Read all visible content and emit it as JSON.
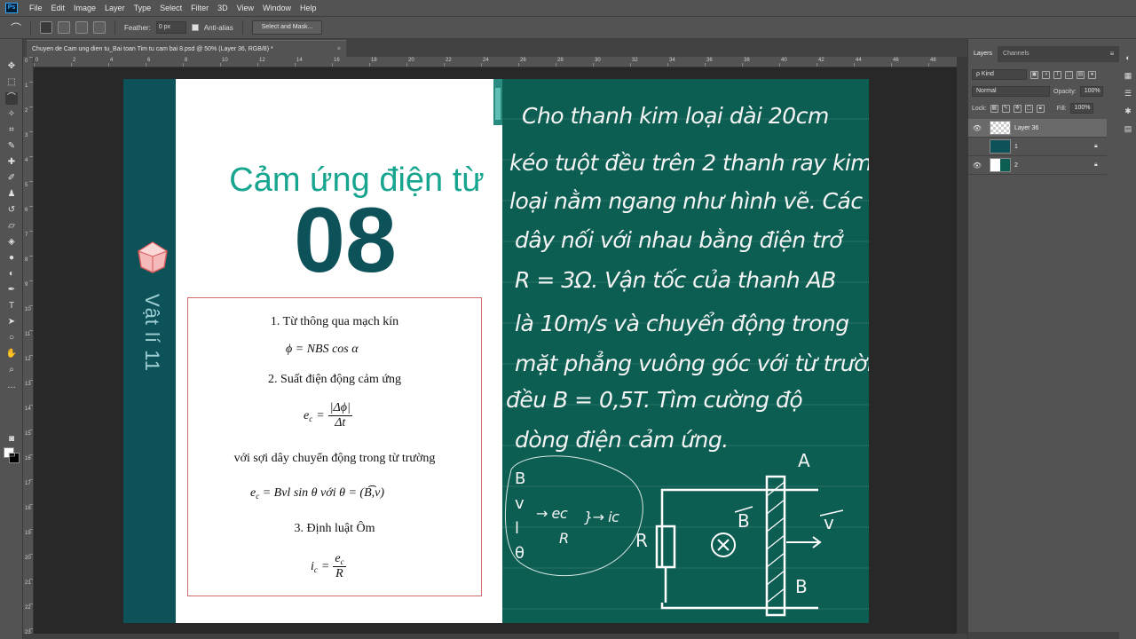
{
  "app": {
    "logo": "Ps",
    "menu": [
      "File",
      "Edit",
      "Image",
      "Layer",
      "Type",
      "Select",
      "Filter",
      "3D",
      "View",
      "Window",
      "Help"
    ]
  },
  "options_bar": {
    "feather_label": "Feather:",
    "feather_value": "0 px",
    "antialias_label": "Anti-alias",
    "select_mask_label": "Select and Mask..."
  },
  "document": {
    "tab_title": "Chuyen de Cam ung dien tu_Bai toan Tim tu cam bai 8.psd @ 50% (Layer 36, RGB/8) *",
    "close": "×",
    "ruler_h": [
      "0",
      "2",
      "4",
      "6",
      "8",
      "10",
      "12",
      "14",
      "16",
      "18",
      "20",
      "22",
      "24",
      "26",
      "28",
      "30",
      "32",
      "34",
      "36",
      "38",
      "40",
      "42",
      "44",
      "46",
      "48",
      "50"
    ],
    "ruler_v": [
      "0",
      "1",
      "2",
      "3",
      "4",
      "5",
      "6",
      "7",
      "8",
      "9",
      "10",
      "11",
      "12",
      "13",
      "14",
      "15",
      "16",
      "17",
      "18",
      "19",
      "20",
      "21",
      "22",
      "23"
    ]
  },
  "slide": {
    "vertical_title": "Vật lí 11",
    "topic_title": "Cảm ứng điện từ",
    "lesson_number": "08",
    "formulas": {
      "h1": "1. Từ thông qua mạch kín",
      "f1": "ϕ = NBS cos α",
      "h2": "2. Suất điện động cảm ứng",
      "f2_lhs": "e",
      "f2_sub": "c",
      "f2_num": "|Δϕ|",
      "f2_den": "Δt",
      "h2b": "với sợi dây chuyển động trong từ trường",
      "f3": "e",
      "f3_sub": "c",
      "f3_rest": " = Bvl sin θ  với  θ = (B͡,v)",
      "h3": "3. Định luật Ôm",
      "f4_lhs": "i",
      "f4_sub": "c",
      "f4_num": "e",
      "f4_num_sub": "c",
      "f4_den": "R"
    },
    "board_lines": [
      "Cho thanh kim loại dài 20cm",
      "kéo tuột đều trên 2 thanh ray kim",
      "loại nằm ngang như hình vẽ. Các",
      "dây nối với nhau bằng điện trở",
      "R = 3Ω. Vận tốc của thanh AB",
      "là 10m/s và chuyển động trong",
      "mặt phẳng vuông góc với từ trường",
      "đều B = 0,5T. Tìm cường độ",
      "dòng điện cảm ứng."
    ],
    "notes": {
      "vars": [
        "B",
        "v",
        "l",
        "θ"
      ],
      "arrow_ec": "→ ec",
      "R": "R",
      "ic": "}→ ic"
    },
    "circuit": {
      "label_A": "A",
      "label_B_end": "B",
      "label_R": "R",
      "label_Bvec": "B",
      "label_v": "v"
    }
  },
  "panels": {
    "tabs": [
      "Layers",
      "Channels"
    ],
    "menu_icon": "≡",
    "kind_label": "ρ Kind",
    "blend_mode": "Normal",
    "opacity_label": "Opacity:",
    "opacity_value": "100%",
    "lock_label": "Lock:",
    "fill_label": "Fill:",
    "fill_value": "100%",
    "layers": [
      {
        "name": "Layer 36",
        "selected": true,
        "visible": true,
        "locked": false
      },
      {
        "name": "1",
        "selected": false,
        "visible": false,
        "locked": true
      },
      {
        "name": "2",
        "selected": false,
        "visible": true,
        "locked": true
      }
    ]
  }
}
